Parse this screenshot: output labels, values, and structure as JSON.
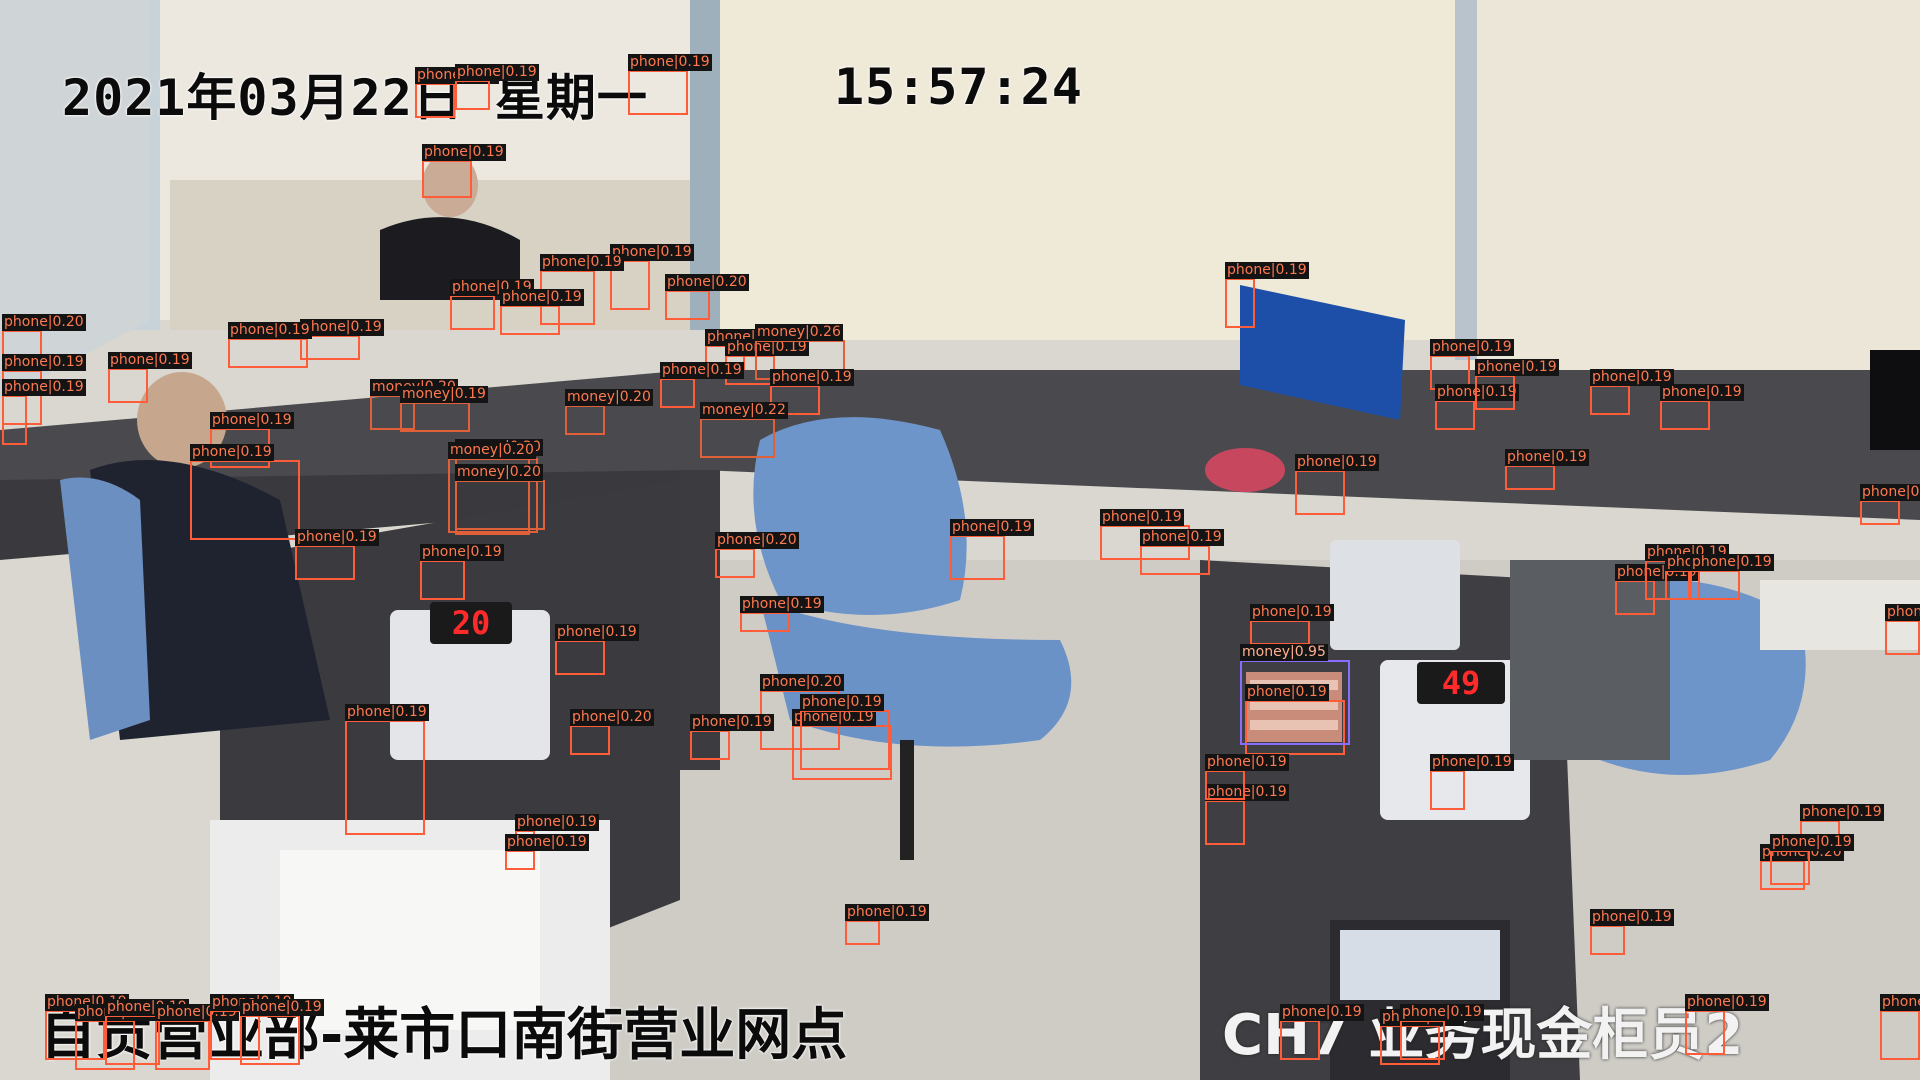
{
  "overlay": {
    "date": "2021年03月22日 星期一",
    "time": "15:57:24",
    "branch": "自贡营业部-莱市口南街营业网点",
    "channel": "CH7 业务现金柜员2"
  },
  "devices": {
    "counter_display_left": "20",
    "counter_display_right": "49"
  },
  "colors": {
    "box": "#ff5c3a",
    "label_bg": "#141414",
    "label_text": "#ff7a50"
  },
  "detections": [
    {
      "label": "phone|0.19"
    },
    {
      "label": "phone|0.19"
    },
    {
      "label": "phone|0.19"
    },
    {
      "label": "phone|0.19"
    },
    {
      "label": "phone|0.19"
    },
    {
      "label": "phone|0.19"
    },
    {
      "label": "phone|0.19"
    },
    {
      "label": "phone|0.19"
    },
    {
      "label": "phone|0.20"
    },
    {
      "label": "phone|0.19"
    },
    {
      "label": "phone|0.19"
    },
    {
      "label": "phone|0.19"
    },
    {
      "label": "money|0.20"
    },
    {
      "label": "phone|0.19"
    },
    {
      "label": "phone|0.19"
    },
    {
      "label": "phone|0.20"
    },
    {
      "label": "money|0.20"
    },
    {
      "label": "phone|0.19"
    },
    {
      "label": "phone|0.19"
    },
    {
      "label": "money|0.26"
    },
    {
      "label": "phone|0.19"
    },
    {
      "label": "phone|0.19"
    },
    {
      "label": "phone|0.19"
    },
    {
      "label": "money|0.19"
    },
    {
      "label": "money|0.20"
    },
    {
      "label": "money|0.22"
    },
    {
      "label": "phone|0.19"
    },
    {
      "label": "phone|0.19"
    },
    {
      "label": "phone|0.19"
    },
    {
      "label": "phone|0.19"
    },
    {
      "label": "phone|0.19"
    },
    {
      "label": "phone|0.19"
    },
    {
      "label": "money|0.20"
    },
    {
      "label": "money|0.20"
    },
    {
      "label": "phone|0.19"
    },
    {
      "label": "phone|0.19"
    },
    {
      "label": "phone|0.19"
    },
    {
      "label": "phone|0.20"
    },
    {
      "label": "phone|0.19"
    },
    {
      "label": "phone|0.20"
    },
    {
      "label": "phone|0.19"
    },
    {
      "label": "phone|0.19"
    },
    {
      "label": "phone|0.19"
    },
    {
      "label": "phone|0.19"
    },
    {
      "label": "phone|0.19"
    },
    {
      "label": "phone|0.19"
    },
    {
      "label": "phone|0.19"
    },
    {
      "label": "phone|0.19"
    },
    {
      "label": "phone|0.19"
    },
    {
      "label": "phone|0.19"
    },
    {
      "label": "phone|0.19"
    },
    {
      "label": "phone|0.19"
    },
    {
      "label": "phone|0.19"
    },
    {
      "label": "phone|0.19"
    },
    {
      "label": "phone|0.19"
    },
    {
      "label": "phone|0.19"
    },
    {
      "label": "phone|0.19"
    },
    {
      "label": "phone|0.19"
    },
    {
      "label": "money|0.95"
    },
    {
      "label": "phone|0.19"
    },
    {
      "label": "phone|0.19"
    },
    {
      "label": "phone|0.19"
    },
    {
      "label": "phone|0.19"
    },
    {
      "label": "phone|0.19"
    },
    {
      "label": "phone|0.19"
    },
    {
      "label": "phone|0.19"
    },
    {
      "label": "phone|0.20"
    },
    {
      "label": "phone|0.19"
    },
    {
      "label": "phone|0.19"
    },
    {
      "label": "phone|0.20"
    },
    {
      "label": "phone|0.19"
    },
    {
      "label": "phone|0.19"
    },
    {
      "label": "phone|0.19"
    },
    {
      "label": "phone|0.19"
    },
    {
      "label": "phone|0.19"
    },
    {
      "label": "phone|0.19"
    },
    {
      "label": "phone|0.19"
    },
    {
      "label": "phone|0.20"
    },
    {
      "label": "phone|0.19"
    },
    {
      "label": "phone|0.19"
    },
    {
      "label": "phone|0.19"
    },
    {
      "label": "phone|0.19"
    }
  ]
}
